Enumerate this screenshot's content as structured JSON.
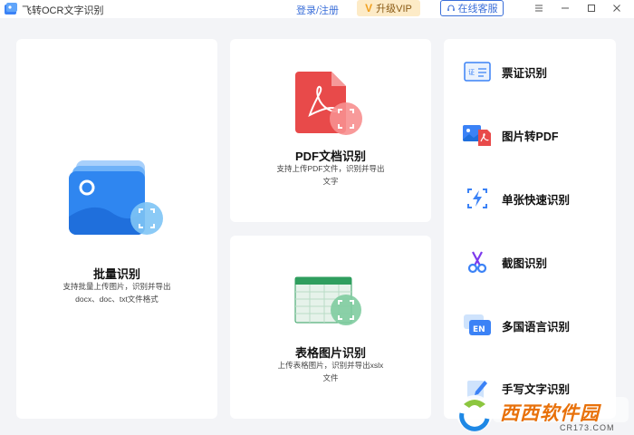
{
  "titlebar": {
    "app_title": "飞转OCR文字识别",
    "login_label": "登录/注册",
    "vip_label": "升级VIP",
    "service_label": "在线客服"
  },
  "cards": {
    "batch": {
      "title": "批量识别",
      "desc_line1": "支持批量上传图片，识别并导出",
      "desc_line2": "docx、doc、txt文件格式"
    },
    "pdf": {
      "title": "PDF文档识别",
      "desc_line1": "支持上传PDF文件，识别并导出",
      "desc_line2": "文字"
    },
    "table": {
      "title": "表格图片识别",
      "desc_line1": "上传表格图片，识别并导出xslx",
      "desc_line2": "文件"
    }
  },
  "sidebar": {
    "items": [
      {
        "label": "票证识别",
        "icon": "id-card-icon"
      },
      {
        "label": "图片转PDF",
        "icon": "image-to-pdf-icon"
      },
      {
        "label": "单张快速识别",
        "icon": "lightning-icon"
      },
      {
        "label": "截图识别",
        "icon": "scissors-icon"
      },
      {
        "label": "多国语言识别",
        "icon": "language-en-icon"
      },
      {
        "label": "手写文字识别",
        "icon": "handwriting-icon"
      }
    ]
  },
  "watermark": {
    "brand": "西西软件园",
    "domain": "CR173.COM"
  },
  "colors": {
    "accent": "#3b6fd9",
    "pdf_red": "#e84a4a",
    "table_green": "#2f9e5e",
    "batch_blue": "#2f86f0"
  }
}
